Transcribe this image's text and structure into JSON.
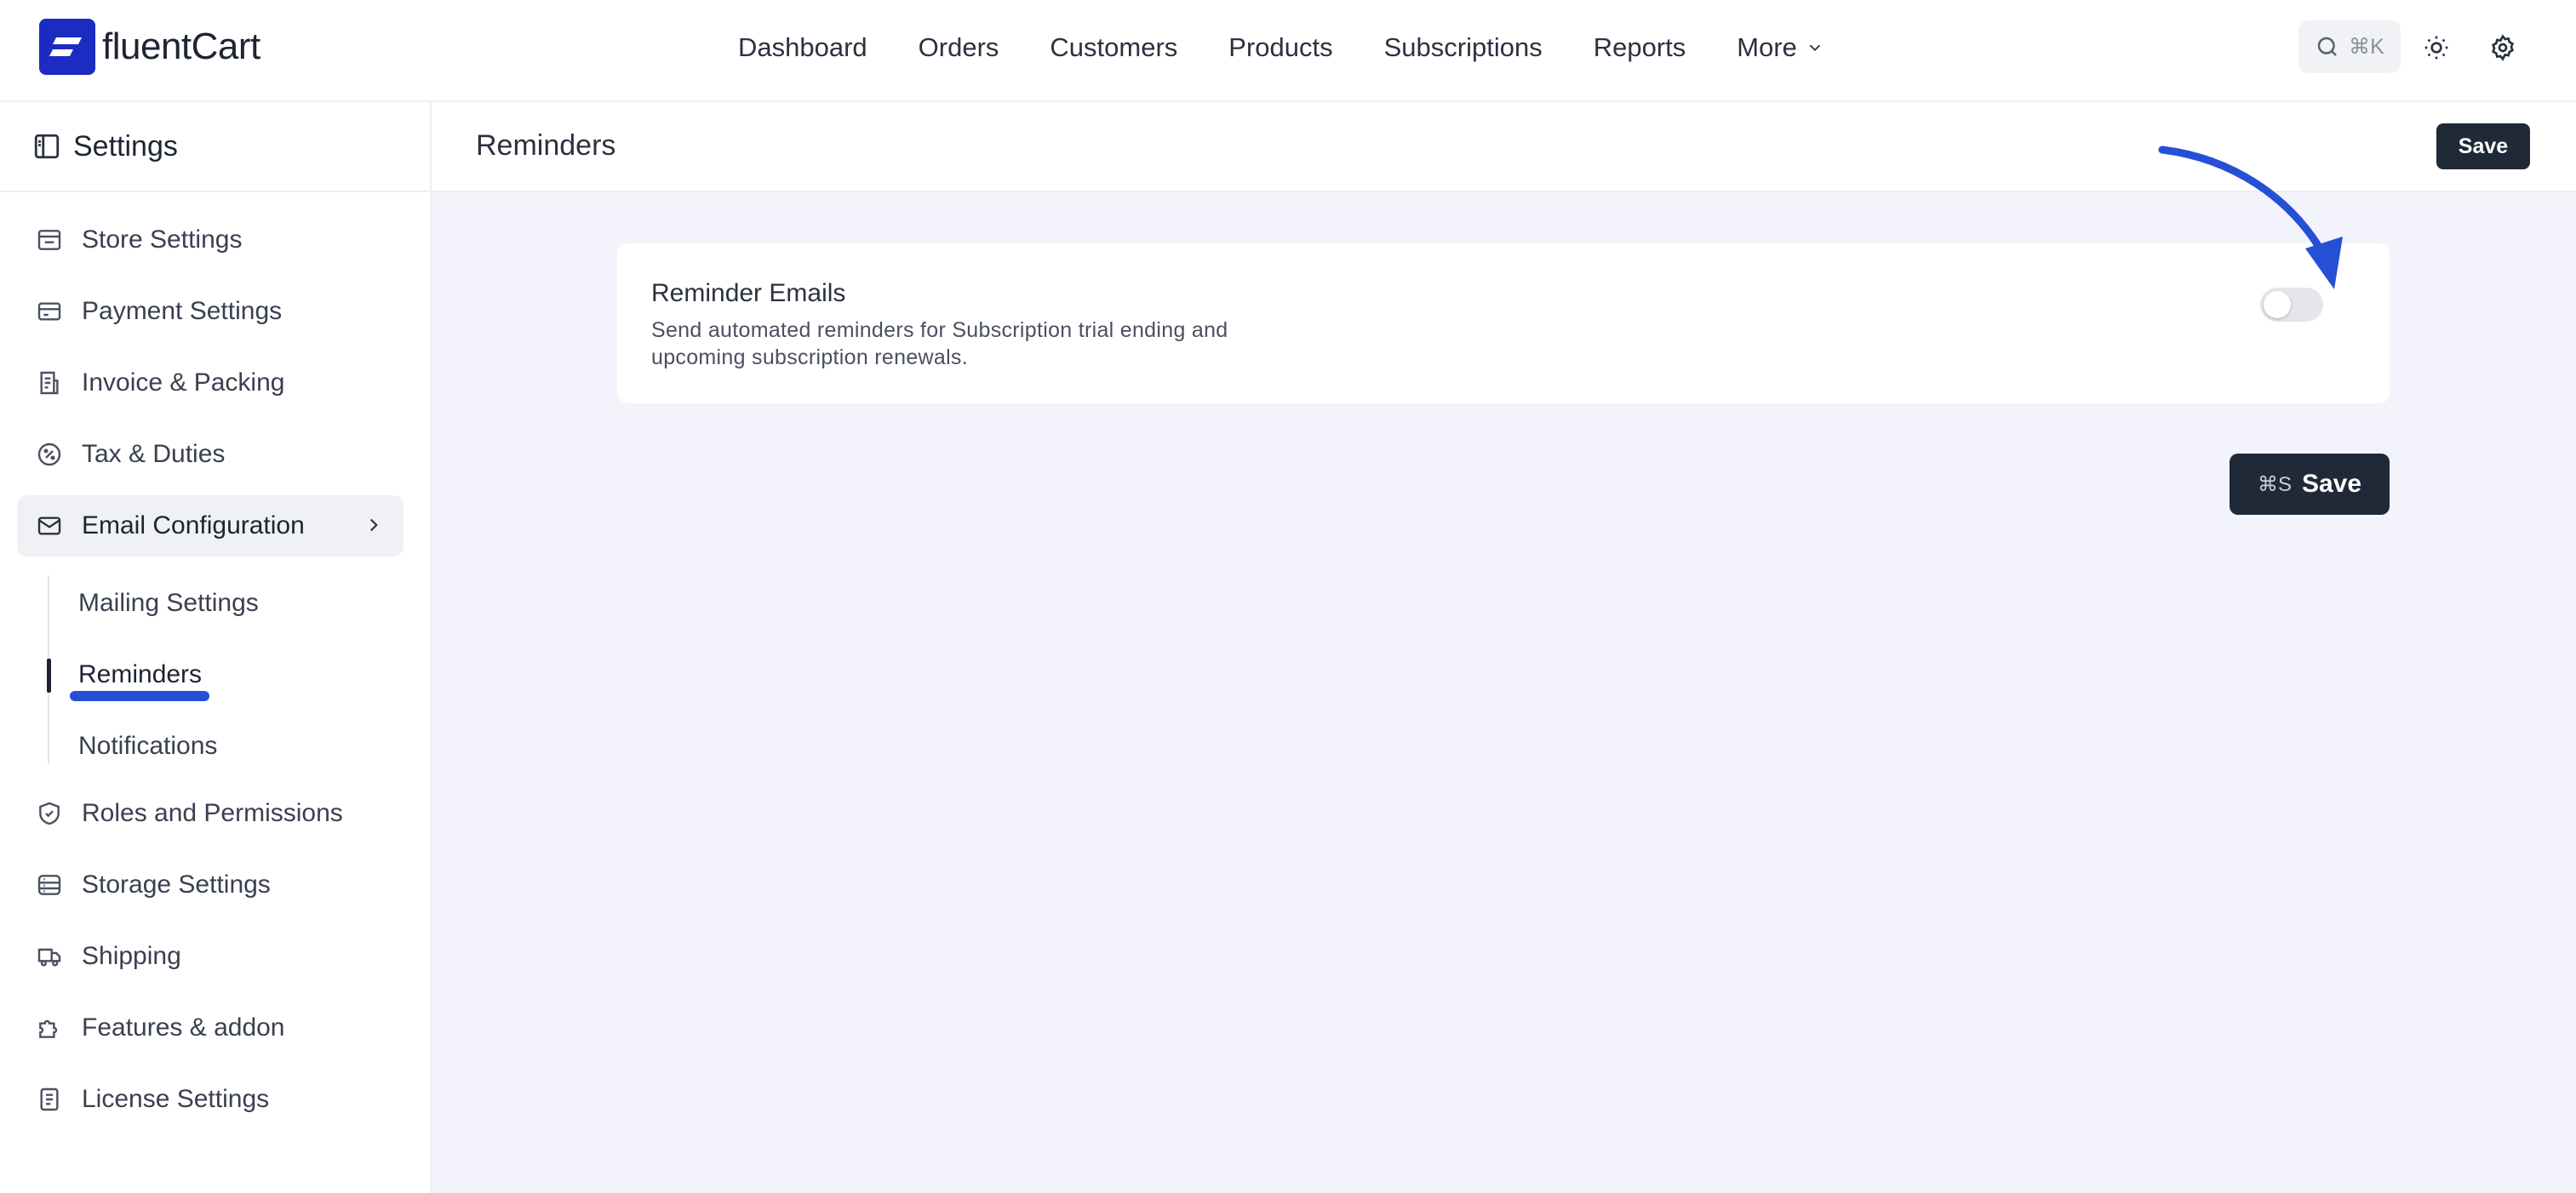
{
  "app": {
    "logo_text_light": "fluent",
    "logo_text_bold": "Cart"
  },
  "nav": {
    "items": [
      "Dashboard",
      "Orders",
      "Customers",
      "Products",
      "Subscriptions",
      "Reports",
      "More"
    ]
  },
  "search": {
    "shortcut": "⌘K"
  },
  "sidebar": {
    "title": "Settings",
    "items": [
      {
        "label": "Store Settings",
        "icon": "store-icon"
      },
      {
        "label": "Payment Settings",
        "icon": "credit-card-icon"
      },
      {
        "label": "Invoice & Packing",
        "icon": "invoice-icon"
      },
      {
        "label": "Tax & Duties",
        "icon": "percent-icon"
      },
      {
        "label": "Email Configuration",
        "icon": "mail-icon"
      },
      {
        "label": "Roles and Permissions",
        "icon": "shield-check-icon"
      },
      {
        "label": "Storage Settings",
        "icon": "storage-icon"
      },
      {
        "label": "Shipping",
        "icon": "truck-icon"
      },
      {
        "label": "Features & addon",
        "icon": "puzzle-icon"
      },
      {
        "label": "License Settings",
        "icon": "license-icon"
      }
    ],
    "submenu": [
      "Mailing Settings",
      "Reminders",
      "Notifications"
    ]
  },
  "main": {
    "title": "Reminders",
    "save_label": "Save",
    "card": {
      "title": "Reminder Emails",
      "description": "Send automated reminders for Subscription trial ending and upcoming subscription renewals.",
      "enabled": false
    },
    "save_bottom_shortcut": "⌘S",
    "save_bottom_label": "Save"
  },
  "colors": {
    "brand": "#1c2bc2",
    "annotation": "#2550d6",
    "button_dark": "#1f2937"
  }
}
